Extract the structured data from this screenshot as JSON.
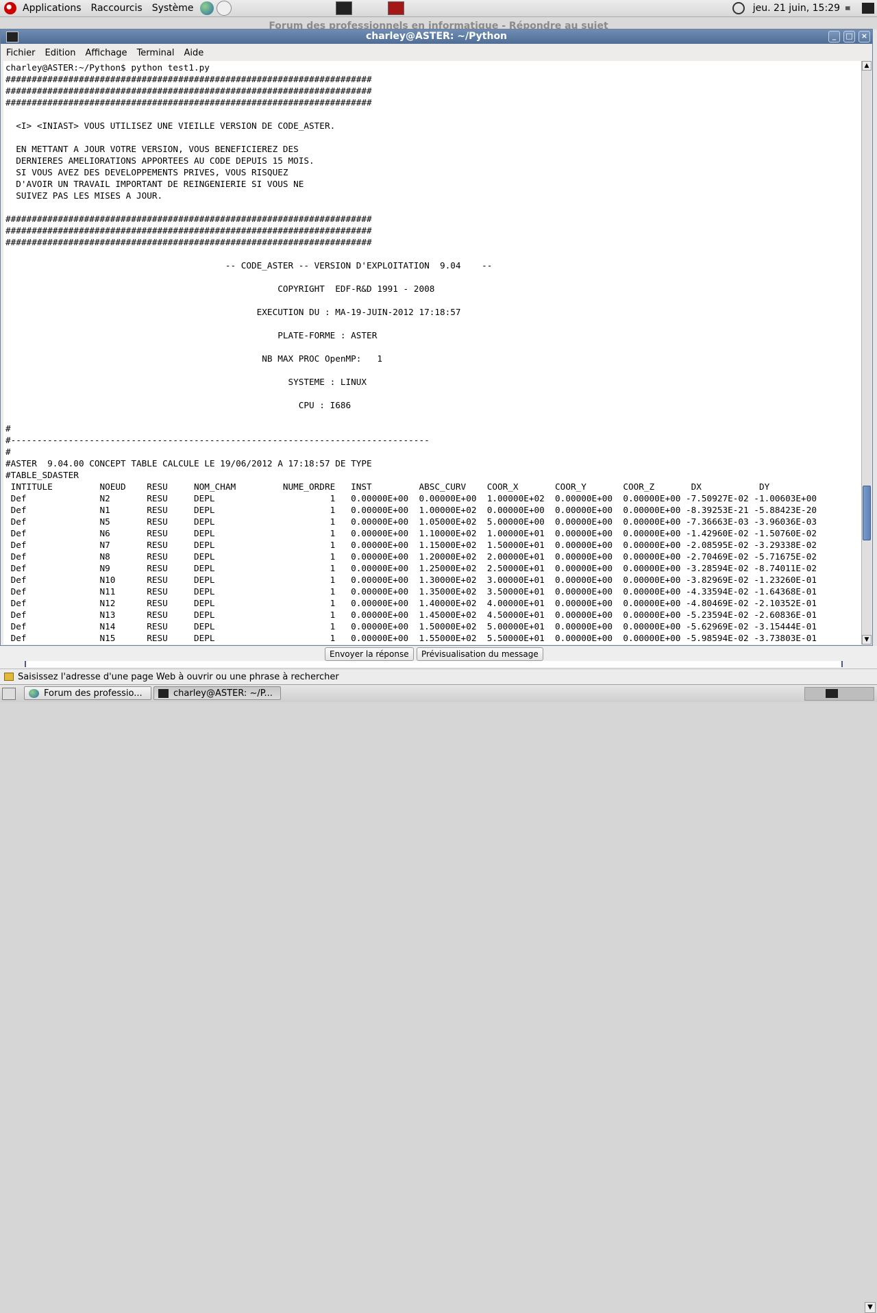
{
  "top_panel": {
    "menus": [
      "Applications",
      "Raccourcis",
      "Système"
    ],
    "clock": "jeu. 21 juin, 15:29"
  },
  "browser": {
    "title": "Forum des professionnels en informatique - Répondre au sujet",
    "buttons": {
      "send": "Envoyer la réponse",
      "preview": "Prévisualisation du message"
    },
    "status": "Saisissez l'adresse d'une page Web à ouvrir ou une phrase à rechercher"
  },
  "terminal": {
    "title": "charley@ASTER: ~/Python",
    "menus": [
      "Fichier",
      "Edition",
      "Affichage",
      "Terminal",
      "Aide"
    ],
    "output": "charley@ASTER:~/Python$ python test1.py\n######################################################################\n######################################################################\n######################################################################\n\n  <I> <INIAST> VOUS UTILISEZ UNE VIEILLE VERSION DE CODE_ASTER.\n\n  EN METTANT A JOUR VOTRE VERSION, VOUS BENEFICIEREZ DES\n  DERNIERES AMELIORATIONS APPORTEES AU CODE DEPUIS 15 MOIS.\n  SI VOUS AVEZ DES DEVELOPPEMENTS PRIVES, VOUS RISQUEZ\n  D'AVOIR UN TRAVAIL IMPORTANT DE REINGENIERIE SI VOUS NE\n  SUIVEZ PAS LES MISES A JOUR.\n\n######################################################################\n######################################################################\n######################################################################\n\n                                          -- CODE_ASTER -- VERSION D'EXPLOITATION  9.04    --\n\n                                                    COPYRIGHT  EDF-R&D 1991 - 2008\n\n                                                EXECUTION DU : MA-19-JUIN-2012 17:18:57\n\n                                                    PLATE-FORME : ASTER\n\n                                                 NB MAX PROC OpenMP:   1\n\n                                                      SYSTEME : LINUX\n\n                                                        CPU : I686\n\n#\n#--------------------------------------------------------------------------------\n#\n#ASTER  9.04.00 CONCEPT TABLE CALCULE LE 19/06/2012 A 17:18:57 DE TYPE\n#TABLE_SDASTER\n INTITULE         NOEUD    RESU     NOM_CHAM         NUME_ORDRE   INST         ABSC_CURV    COOR_X       COOR_Y       COOR_Z       DX           DY\n Def              N2       RESU     DEPL                      1   0.00000E+00  0.00000E+00  1.00000E+02  0.00000E+00  0.00000E+00 -7.50927E-02 -1.00603E+00\n Def              N1       RESU     DEPL                      1   0.00000E+00  1.00000E+02  0.00000E+00  0.00000E+00  0.00000E+00 -8.39253E-21 -5.88423E-20\n Def              N5       RESU     DEPL                      1   0.00000E+00  1.05000E+02  5.00000E+00  0.00000E+00  0.00000E+00 -7.36663E-03 -3.96036E-03\n Def              N6       RESU     DEPL                      1   0.00000E+00  1.10000E+02  1.00000E+01  0.00000E+00  0.00000E+00 -1.42960E-02 -1.50760E-02\n Def              N7       RESU     DEPL                      1   0.00000E+00  1.15000E+02  1.50000E+01  0.00000E+00  0.00000E+00 -2.08595E-02 -3.29338E-02\n Def              N8       RESU     DEPL                      1   0.00000E+00  1.20000E+02  2.00000E+01  0.00000E+00  0.00000E+00 -2.70469E-02 -5.71675E-02\n Def              N9       RESU     DEPL                      1   0.00000E+00  1.25000E+02  2.50000E+01  0.00000E+00  0.00000E+00 -3.28594E-02 -8.74011E-02\n Def              N10      RESU     DEPL                      1   0.00000E+00  1.30000E+02  3.00000E+01  0.00000E+00  0.00000E+00 -3.82969E-02 -1.23260E-01\n Def              N11      RESU     DEPL                      1   0.00000E+00  1.35000E+02  3.50000E+01  0.00000E+00  0.00000E+00 -4.33594E-02 -1.64368E-01\n Def              N12      RESU     DEPL                      1   0.00000E+00  1.40000E+02  4.00000E+01  0.00000E+00  0.00000E+00 -4.80469E-02 -2.10352E-01\n Def              N13      RESU     DEPL                      1   0.00000E+00  1.45000E+02  4.50000E+01  0.00000E+00  0.00000E+00 -5.23594E-02 -2.60836E-01\n Def              N14      RESU     DEPL                      1   0.00000E+00  1.50000E+02  5.00000E+01  0.00000E+00  0.00000E+00 -5.62969E-02 -3.15444E-01\n Def              N15      RESU     DEPL                      1   0.00000E+00  1.55000E+02  5.50000E+01  0.00000E+00  0.00000E+00 -5.98594E-02 -3.73803E-01"
  },
  "taskbar": {
    "tasks": [
      "Forum des professio...",
      "charley@ASTER: ~/P..."
    ]
  }
}
